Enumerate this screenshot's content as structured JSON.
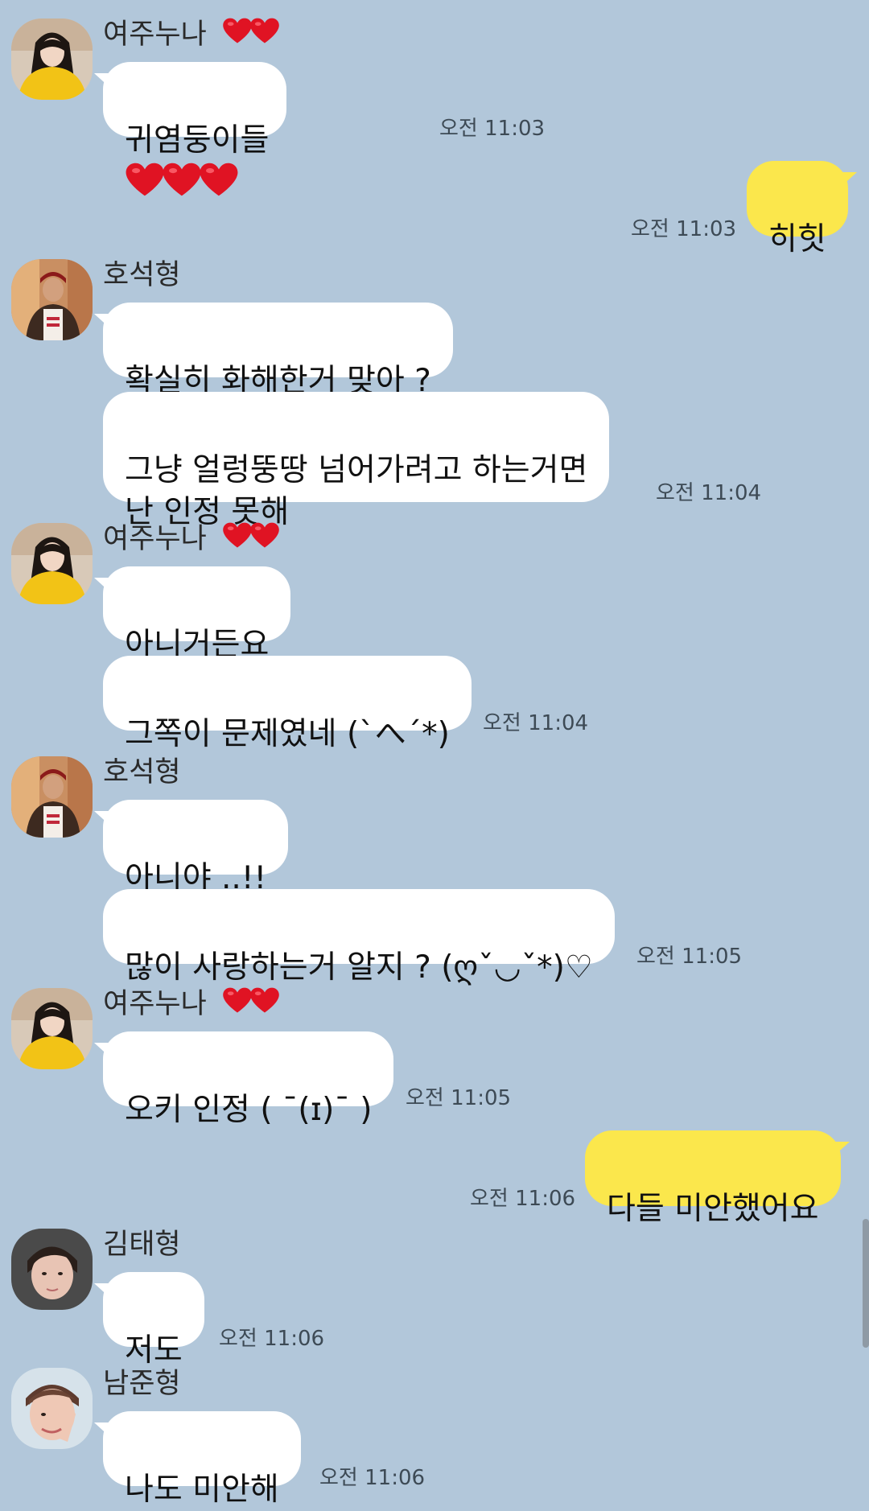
{
  "colors": {
    "background": "#b2c7da",
    "bubble_incoming": "#ffffff",
    "bubble_outgoing": "#fbe74c",
    "heart": "#e01323"
  },
  "messages": {
    "m1": {
      "sender": "여주누나",
      "text": "귀염둥이들",
      "time": "오전 11:03"
    },
    "m2": {
      "text": "히힛",
      "time": "오전 11:03"
    },
    "m3": {
      "sender": "호석형",
      "text1": "확실히 화해한거 맞아 ?",
      "text2": "그냥 얼렁뚱땅 넘어가려고 하는거면\n난 인정 못해",
      "time": "오전 11:04"
    },
    "m4": {
      "sender": "여주누나",
      "text1": "아니거든요",
      "text2": "그쪽이 문제였네 (`へ´*)",
      "time": "오전 11:04"
    },
    "m5": {
      "sender": "호석형",
      "text1": "아니야 ..!!",
      "text2": "많이 사랑하는거 알지 ? (ღˇ◡ˇ*)♡",
      "time": "오전 11:05"
    },
    "m6": {
      "sender": "여주누나",
      "text": "오키 인정 ( ¯(ɪ)¯ )",
      "time": "오전 11:05"
    },
    "m7": {
      "text": "다들 미안했어요",
      "time": "오전 11:06"
    },
    "m8": {
      "sender": "김태형",
      "text": "저도",
      "time": "오전 11:06"
    },
    "m9": {
      "sender": "남준형",
      "text": "나도 미안해",
      "time": "오전 11:06"
    }
  },
  "icons": {
    "heart": "heart-icon",
    "avatar": "profile-avatar"
  }
}
